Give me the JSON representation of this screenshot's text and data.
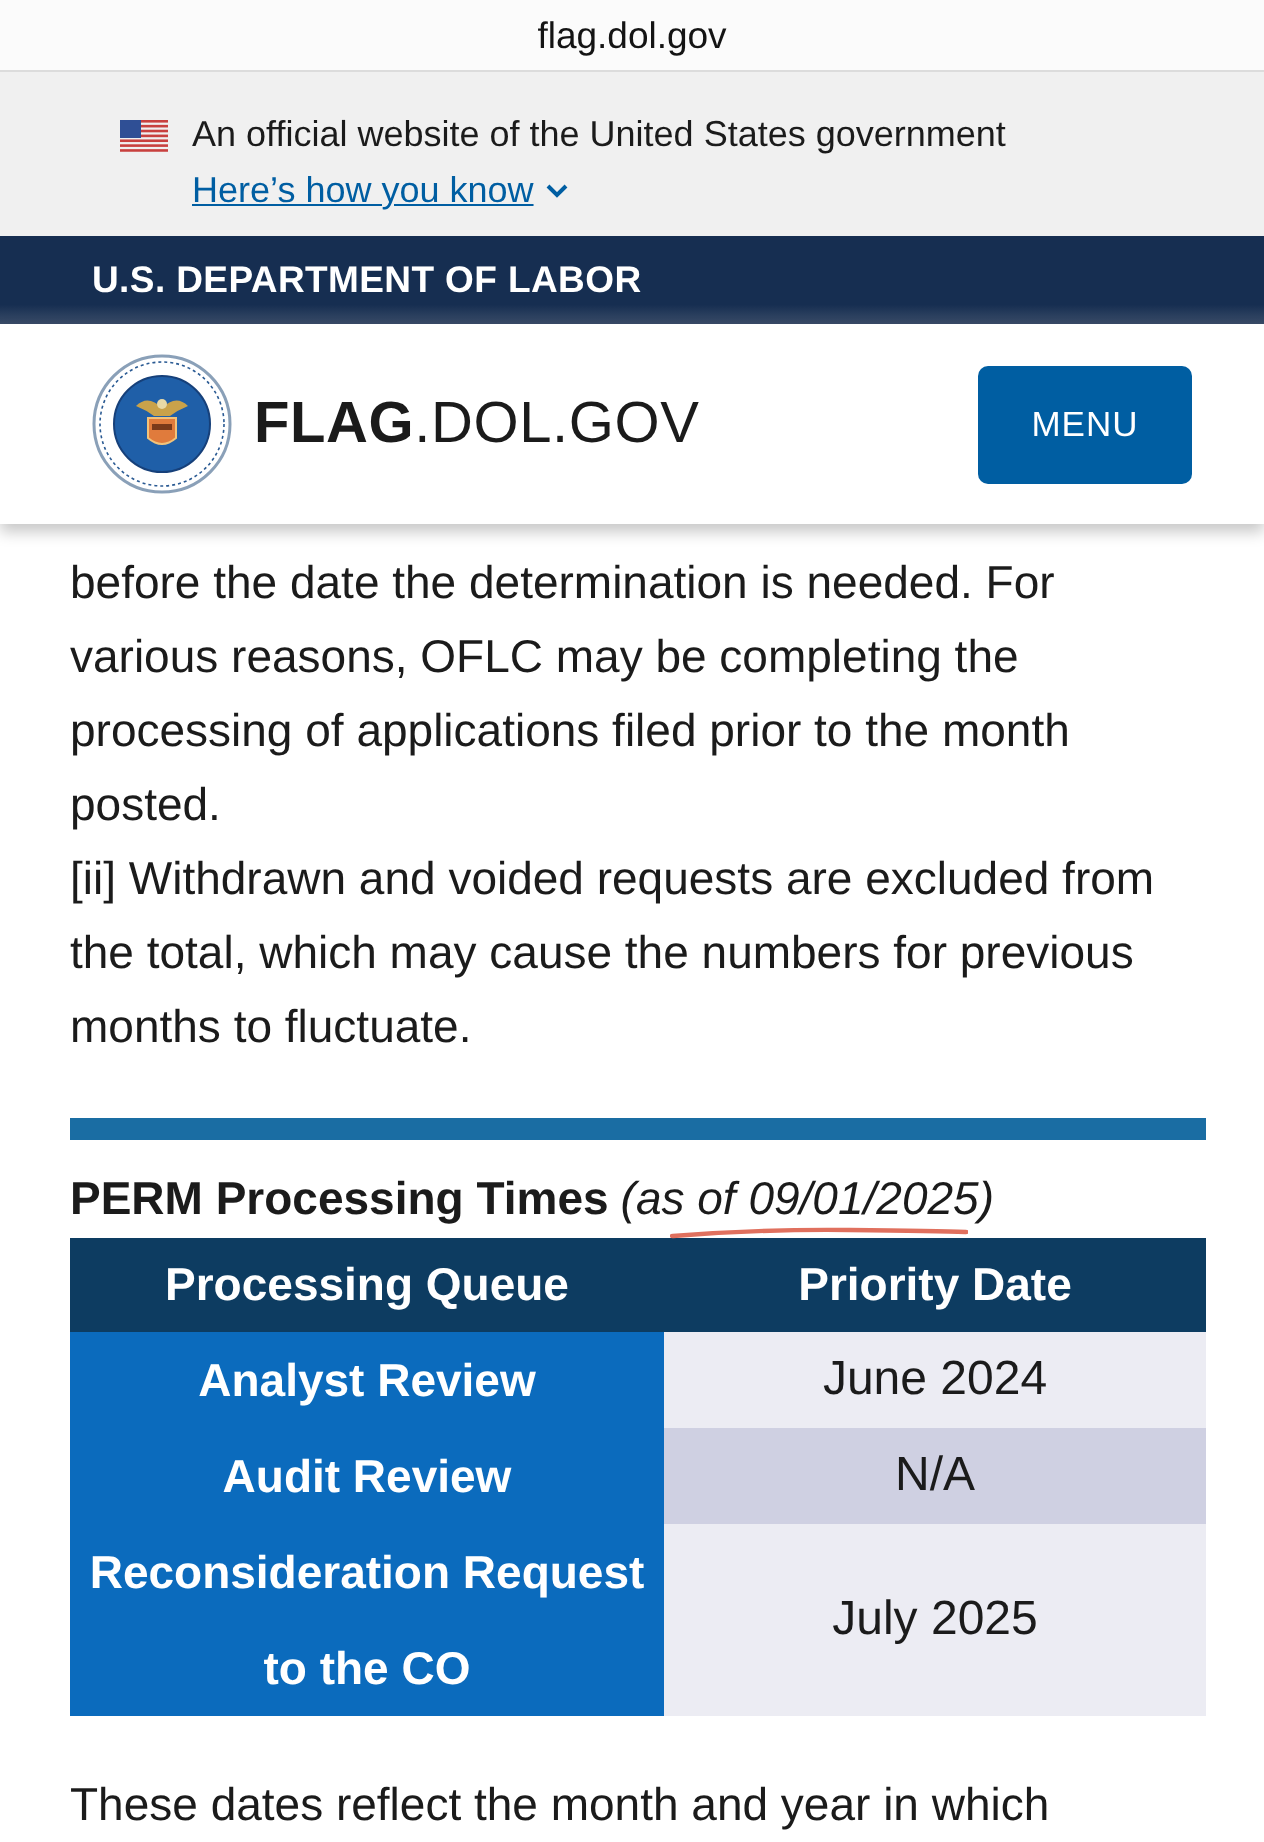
{
  "browser": {
    "url": "flag.dol.gov"
  },
  "gov_banner": {
    "text": "An official website of the United States government",
    "link": "Here’s how you know",
    "expanded": false
  },
  "agency_bar": {
    "title": "U.S. DEPARTMENT OF LABOR"
  },
  "site_header": {
    "site_name": "**FLAG**.DOL.GOV",
    "menu_button": "MENU"
  },
  "content": {
    "paragraphs": [
      "before the date the determination is needed. For various reasons, OFLC may be completing the processing of applications filed prior to the month posted.",
      "[ii] Withdrawn and voided requests are excluded from the total, which may cause the numbers for previous months to fluctuate."
    ],
    "section": {
      "title": "PERM Processing Times",
      "note": "(as of 09/01/2025)"
    },
    "table": {
      "columns": [
        "Processing Queue",
        "Priority Date"
      ],
      "rows": [
        {
          "queue": "Analyst Review",
          "priority_date": "June 2024"
        },
        {
          "queue": "Audit Review",
          "priority_date": "N/A"
        },
        {
          "queue": "Reconsideration Request to the CO",
          "priority_date": "July 2025"
        }
      ]
    },
    "trailing_text": "These dates reflect the month and year in which"
  }
}
